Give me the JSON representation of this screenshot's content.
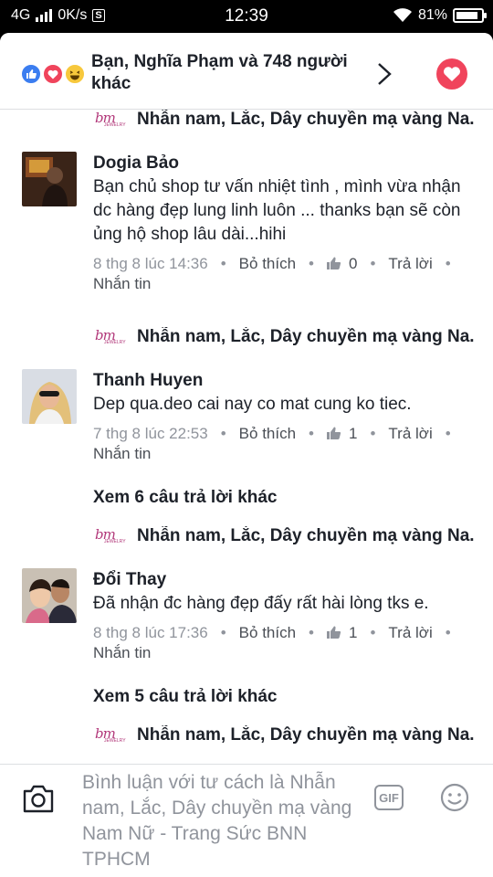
{
  "status_bar": {
    "network": "4G",
    "speed": "0K/s",
    "sim_badge": "S",
    "time": "12:39",
    "battery_percent": "81%",
    "battery_level": 0.81
  },
  "reactions_header": {
    "text": "Bạn, Nghĩa Phạm và 748 người khác",
    "icons": [
      "like-icon",
      "love-icon",
      "haha-icon"
    ]
  },
  "page_name": "Nhẫn nam, Lắc, Dây chuyền mạ vàng Na.",
  "comments": [
    {
      "name": "Dogia Bảo",
      "text": "Bạn chủ shop tư vấn nhiệt tình , mình vừa nhận dc hàng đẹp lung linh luôn ... thanks bạn sẽ còn ủng hộ shop lâu dài...hihi",
      "time": "8 thg 8 lúc 14:36",
      "unlike": "Bỏ thích",
      "likes": "0",
      "reply": "Trả lời",
      "message": "Nhắn tin"
    },
    {
      "name": "Thanh Huyen",
      "text": "Dep qua.deo cai nay co mat cung ko tiec.",
      "time": "7 thg 8 lúc 22:53",
      "unlike": "Bỏ thích",
      "likes": "1",
      "reply": "Trả lời",
      "message": "Nhắn tin",
      "more_replies": "Xem 6 câu trả lời khác"
    },
    {
      "name": "Đổi Thay",
      "text": "Đã nhận đc hàng đẹp đấy rất hài lòng tks e.",
      "time": "8 thg 8 lúc 17:36",
      "unlike": "Bỏ thích",
      "likes": "1",
      "reply": "Trả lời",
      "message": "Nhắn tin",
      "more_replies": "Xem 5 câu trả lời khác"
    }
  ],
  "composer": {
    "placeholder": "Bình luận với tư cách là Nhẫn nam, Lắc, Dây chuyền mạ vàng Nam Nữ - Trang Sức BNN TPHCM",
    "gif_label": "GIF"
  },
  "colors": {
    "text_primary": "#1d2129",
    "text_meta": "#90949c",
    "like_blue": "#3b7df0",
    "love_red": "#f0445c",
    "logo_pink": "#b2387a"
  }
}
